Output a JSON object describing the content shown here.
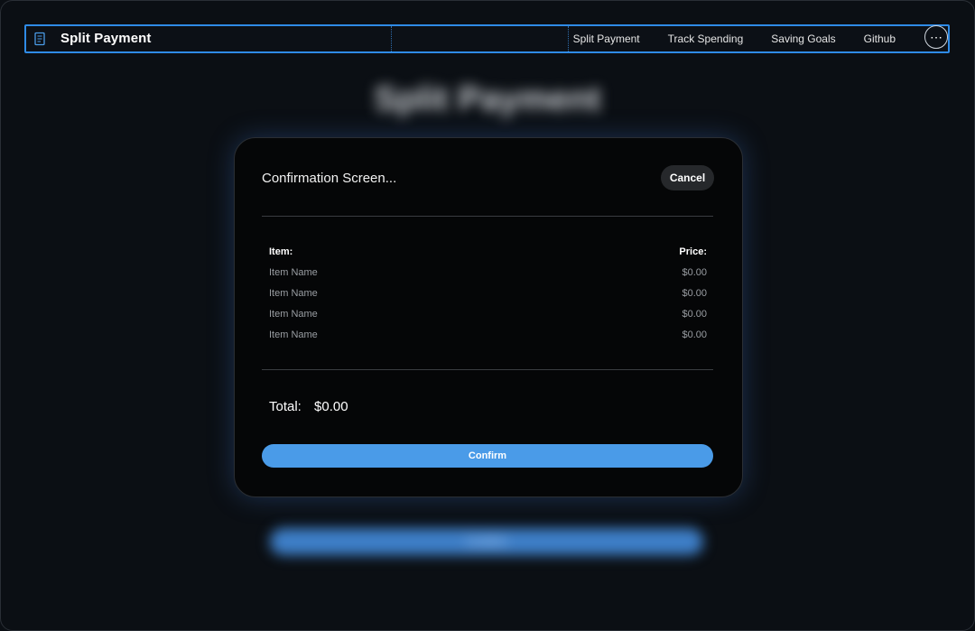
{
  "navbar": {
    "brand_title": "Split Payment",
    "brand_icon": "receipt-icon",
    "links": [
      "Split Payment",
      "Track Spending",
      "Saving Goals",
      "Github"
    ],
    "more_icon": "ellipsis-icon",
    "more_label": "⋯"
  },
  "background": {
    "title": "Split Payment",
    "button_label": "Confirm"
  },
  "modal": {
    "title": "Confirmation Screen...",
    "cancel_label": "Cancel",
    "table": {
      "headers": {
        "item": "Item:",
        "price": "Price:"
      },
      "rows": [
        {
          "name": "Item Name",
          "price": "$0.00"
        },
        {
          "name": "Item Name",
          "price": "$0.00"
        },
        {
          "name": "Item Name",
          "price": "$0.00"
        },
        {
          "name": "Item Name",
          "price": "$0.00"
        }
      ]
    },
    "total_label": "Total:",
    "total_value": "$0.00",
    "confirm_label": "Confirm"
  },
  "colors": {
    "accent": "#4a9be8",
    "nav_outline": "#2f8be6",
    "background": "#0b0f14",
    "modal_bg": "#050607"
  }
}
